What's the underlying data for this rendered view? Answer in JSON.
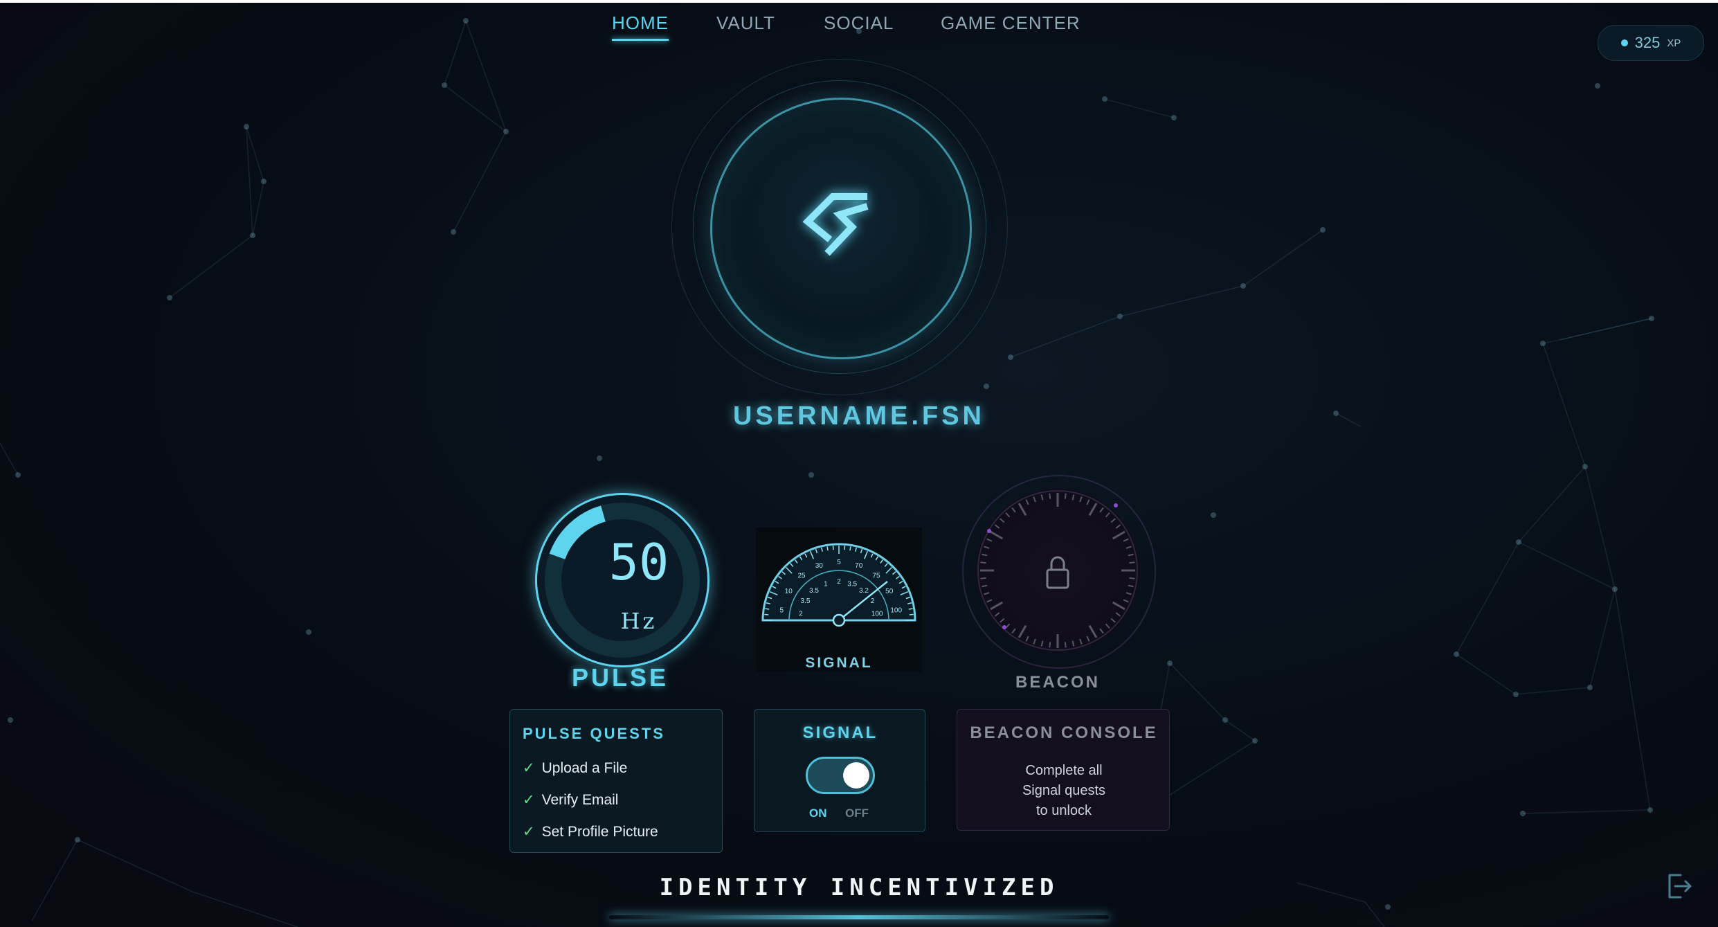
{
  "nav": {
    "items": [
      {
        "label": "HOME",
        "active": true
      },
      {
        "label": "VAULT",
        "active": false
      },
      {
        "label": "SOCIAL",
        "active": false
      },
      {
        "label": "GAME CENTER",
        "active": false
      }
    ]
  },
  "xp": {
    "value": "325",
    "unit": "XP"
  },
  "profile": {
    "username": "USERNAME.FSN",
    "logo_icon": "fusion-logo-icon"
  },
  "pulse": {
    "value": "50",
    "unit": "Hz",
    "label": "PULSE",
    "level": 0.15
  },
  "signal": {
    "label": "SIGNAL",
    "gauge_outer_ticks": [
      "5",
      "10",
      "25",
      "30",
      "5",
      "70",
      "75",
      "50",
      "100"
    ],
    "gauge_inner_ticks": [
      "2",
      "3.5",
      "3.5",
      "1",
      "2",
      "3.5",
      "3.2",
      "2",
      "100"
    ]
  },
  "beacon": {
    "label": "BEACON",
    "state_icon": "lock-icon"
  },
  "pulse_quests": {
    "title": "PULSE QUESTS",
    "items": [
      "Upload a File",
      "Verify Email",
      "Set Profile Picture"
    ]
  },
  "signal_panel": {
    "title": "SIGNAL",
    "on_label": "ON",
    "off_label": "OFF",
    "toggle_state": "on"
  },
  "beacon_console": {
    "title": "BEACON CONSOLE",
    "lines": [
      "Complete all",
      "Signal quests",
      "to unlock"
    ]
  },
  "tagline": "IDENTITY INCENTIVIZED",
  "colors": {
    "accent": "#5fd4ee",
    "check": "#5fe08a",
    "background": "#070d14",
    "beacon": "#8a8f99"
  }
}
